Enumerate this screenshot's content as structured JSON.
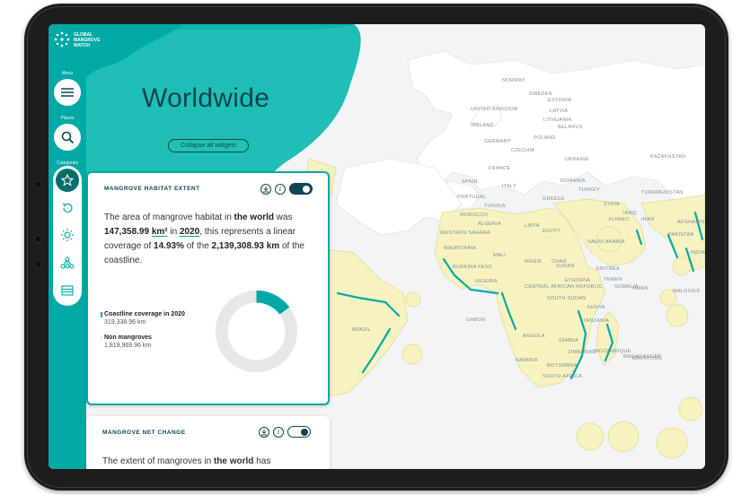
{
  "app": {
    "logo_text": [
      "GLOBAL",
      "MANGROVE",
      "WATCH"
    ]
  },
  "sidebar": {
    "menu_label": "Menu",
    "places_label": "Places",
    "categories_label": "Categories",
    "menu_icon": "hamburger-icon",
    "places_icon": "search-icon",
    "categories": [
      {
        "icon": "star-icon",
        "active": true
      },
      {
        "icon": "history-icon",
        "active": false
      },
      {
        "icon": "sun-icon",
        "active": false
      },
      {
        "icon": "network-icon",
        "active": false
      },
      {
        "icon": "card-icon",
        "active": false
      }
    ]
  },
  "hero": {
    "title": "Worldwide",
    "collapse_label": "Collapse all widgets"
  },
  "widget_extent": {
    "title": "MANGROVE HABITAT EXTENT",
    "toggle_on": true,
    "text_1": "The area of mangrove habitat in ",
    "location": "the world",
    "text_2": " was",
    "area_value": "147,358.99",
    "area_unit": "km²",
    "text_3": " in ",
    "year": "2020",
    "text_4": ", this represents a linear coverage of ",
    "coverage_pct": "14.93%",
    "text_5": " of the ",
    "coastline_value": "2,139,308.93 km",
    "text_6": " of the coastline.",
    "legend": [
      {
        "label": "Coastline coverage in 2020",
        "value": "319,338.96 km",
        "color": "#00a9a5"
      },
      {
        "label": "Non mangroves",
        "value": "1,819,969.96 km",
        "color": "#e6e7e8"
      }
    ],
    "coverage_fraction": 0.1493
  },
  "widget_net_change": {
    "title": "MANGROVE NET CHANGE",
    "toggle_on": false,
    "text_1": "The extent of mangroves in ",
    "location": "the world",
    "text_2": " has"
  },
  "map": {
    "labels": [
      "UNITED KINGDOM",
      "IRELAND",
      "NORWAY",
      "SWEDEN",
      "ESTONIA",
      "LATVIA",
      "LITHUANIA",
      "BELARUS",
      "POLAND",
      "GERMANY",
      "CZECHIA",
      "FRANCE",
      "UKRAINE",
      "ROMANIA",
      "ITALY",
      "SPAIN",
      "PORTUGAL",
      "GREECE",
      "TURKEY",
      "SYRIA",
      "IRAQ",
      "IRAN",
      "TUNISIA",
      "MOROCCO",
      "ALGERIA",
      "LIBYA",
      "EGYPT",
      "SAUDI ARABIA",
      "KUWAIT",
      "KAZAKHSTAN",
      "TURKMENISTAN",
      "AFGHANISTAN",
      "PAKISTAN",
      "INDIA",
      "WESTERN SAHARA",
      "MAURITANIA",
      "MALI",
      "NIGER",
      "CHAD",
      "SUDAN",
      "ERITREA",
      "YEMEN",
      "OMAN",
      "BURKINA FASO",
      "NIGERIA",
      "ETHIOPIA",
      "SOMALIA",
      "CENTRAL AFRICAN REPUBLIC",
      "SOUTH SUDAN",
      "KENYA",
      "TANZANIA",
      "ANGOLA",
      "ZAMBIA",
      "NAMIBIA",
      "BOTSWANA",
      "ZIMBABWE",
      "MOZAMBIQUE",
      "MADAGASCAR",
      "SOUTH AFRICA",
      "MAURITIUS",
      "GABON",
      "BRAZIL",
      "MALDIVES"
    ]
  }
}
